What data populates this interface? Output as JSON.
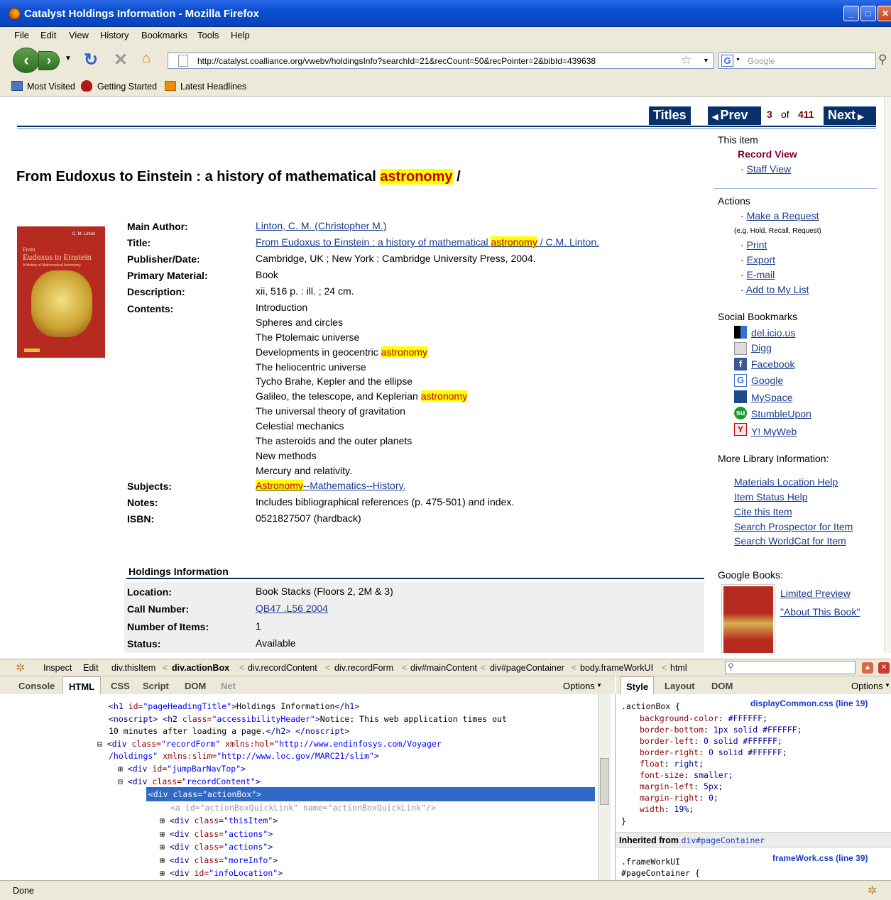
{
  "window": {
    "title": "Catalyst Holdings Information - Mozilla Firefox"
  },
  "menu": [
    "File",
    "Edit",
    "View",
    "History",
    "Bookmarks",
    "Tools",
    "Help"
  ],
  "url": "http://catalyst.coalliance.org/vwebv/holdingsInfo?searchId=21&recCount=50&recPointer=2&bibId=439638",
  "search_placeholder": "Google",
  "bookmarks": [
    "Most Visited",
    "Getting Started",
    "Latest Headlines"
  ],
  "nav": {
    "titles": "Titles",
    "prev": "Prev",
    "current": "3",
    "of": "of",
    "total": "411",
    "next": "Next"
  },
  "record": {
    "title_main": "From Eudoxus to Einstein : a history of mathematical ",
    "title_hl": "astronomy",
    "title_end": " /",
    "cover": {
      "line1": "From",
      "line2": "Eudoxus to Einstein",
      "line3": "A History of Mathematical Astronomy",
      "author": "C. M. Linton"
    },
    "labels": {
      "author": "Main Author:",
      "title": "Title:",
      "publisher": "Publisher/Date:",
      "material": "Primary Material:",
      "description": "Description:",
      "contents": "Contents:",
      "subjects": "Subjects:",
      "notes": "Notes:",
      "isbn": "ISBN:"
    },
    "author": "Linton, C. M. (Christopher M.)",
    "title_link_a": "From Eudoxus to Einstein : a history of mathematical ",
    "title_link_hl": "astronomy",
    "title_link_b": " / C.M. Linton.",
    "publisher": "Cambridge, UK ; New York : Cambridge University Press, 2004.",
    "material": "Book",
    "description": "xii, 516 p. : ill. ; 24 cm.",
    "contents": [
      "Introduction",
      "Spheres and circles",
      "The Ptolemaic universe",
      "Developments in geocentric ",
      "The heliocentric universe",
      "Tycho Brahe, Kepler and the ellipse",
      "Galileo, the telescope, and Keplerian ",
      "The universal theory of gravitation",
      "Celestial mechanics",
      "The asteroids and the outer planets",
      "New methods",
      "Mercury and relativity."
    ],
    "contents_hl": "astronomy",
    "subject_hl": "Astronomy",
    "subject_rest": "--Mathematics--History.",
    "notes": "Includes bibliographical references (p. 475-501) and index.",
    "isbn": "0521827507 (hardback)"
  },
  "holdings": {
    "heading": "Holdings Information",
    "location_label": "Location:",
    "location": "Book Stacks (Floors 2, 2M & 3)",
    "call_label": "Call Number:",
    "call": "QB47 .L56 2004",
    "items_label": "Number of Items:",
    "items": "1",
    "status_label": "Status:",
    "status": "Available"
  },
  "sidebar": {
    "this_item": "This item",
    "record_view": "Record View",
    "staff_view": "Staff View",
    "actions": "Actions",
    "make_request": "Make a Request",
    "request_note": "(e.g. Hold, Recall, Request)",
    "action_links": [
      "Print",
      "Export",
      "E-mail",
      "Add to My List"
    ],
    "social": "Social Bookmarks",
    "social_links": [
      "del.icio.us",
      "Digg",
      "Facebook",
      "Google",
      "MySpace",
      "StumbleUpon",
      "Y! MyWeb"
    ],
    "more_info": "More Library Information:",
    "more_links": [
      "Materials Location Help",
      "Item Status Help",
      "Cite this Item",
      "Search Prospector for Item",
      "Search WorldCat for Item"
    ],
    "google_books": "Google Books:",
    "gb_links": [
      "Limited Preview",
      "\"About This Book\""
    ]
  },
  "firebug": {
    "toolbar": [
      "Inspect",
      "Edit"
    ],
    "crumbs": [
      "div.thisItem",
      "div.actionBox",
      "div.recordContent",
      "div.recordForm",
      "div#mainContent",
      "div#pageContainer",
      "body.frameWorkUI",
      "html"
    ],
    "tabs": [
      "Console",
      "HTML",
      "CSS",
      "Script",
      "DOM",
      "Net"
    ],
    "options": "Options",
    "style_tabs": [
      "Style",
      "Layout",
      "DOM"
    ],
    "style_options": "Options",
    "rule_selector": ".actionBox {",
    "rule_source": "displayCommon.css (line 19)",
    "props": [
      [
        "background-color",
        "#FFFFFF;"
      ],
      [
        "border-bottom",
        "1px solid #FFFFFF;"
      ],
      [
        "border-left",
        "0 solid #FFFFFF;"
      ],
      [
        "border-right",
        "0 solid #FFFFFF;"
      ],
      [
        "float",
        "right;"
      ],
      [
        "font-size",
        "smaller;"
      ],
      [
        "margin-left",
        "5px;"
      ],
      [
        "margin-right",
        "0;"
      ],
      [
        "width",
        "19%;"
      ]
    ],
    "rule_close": "}",
    "inherited_label": "Inherited from ",
    "inherited_from": "div#pageContainer",
    "rule2_selector_a": ".frameWorkUI",
    "rule2_selector_b": "#pageContainer {",
    "rule2_source": "frameWork.css (line 39)"
  },
  "status": "Done"
}
